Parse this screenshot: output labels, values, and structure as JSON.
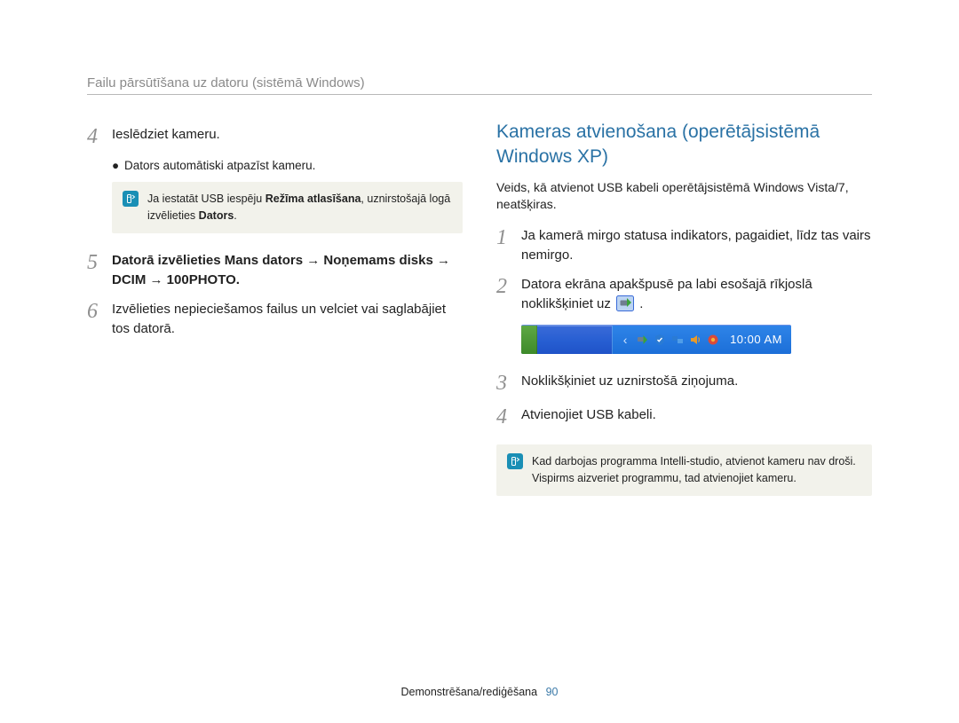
{
  "header": {
    "title": "Failu pārsūtīšana uz datoru (sistēmā Windows)"
  },
  "left": {
    "step4": {
      "num": "4",
      "text": "Ieslēdziet kameru.",
      "bullet": "Dators automātiski atpazīst kameru."
    },
    "note1": {
      "pre": "Ja iestatāt USB iespēju ",
      "bold1": "Režīma atlasīšana",
      "mid": ", uznirstošajā logā izvēlieties ",
      "bold2": "Dators",
      "post": "."
    },
    "step5": {
      "num": "5",
      "pre": "Datorā izvēlieties ",
      "path": "Mans dators → Noņemams disks → DCIM → 100PHOTO",
      "post": "."
    },
    "step6": {
      "num": "6",
      "text": "Izvēlieties nepieciešamos failus un velciet vai saglabājiet tos datorā."
    }
  },
  "right": {
    "title": "Kameras atvienošana (operētājsistēmā Windows XP)",
    "intro": "Veids, kā atvienot USB kabeli operētājsistēmā Windows Vista/7, neatšķiras.",
    "step1": {
      "num": "1",
      "text": "Ja kamerā mirgo statusa indikators, pagaidiet, līdz tas vairs nemirgo."
    },
    "step2": {
      "num": "2",
      "pre": "Datora ekrāna apakšpusē pa labi esošajā rīkjoslā noklikšķiniet uz ",
      "post": "."
    },
    "taskbar": {
      "clock": "10:00 AM"
    },
    "step3": {
      "num": "3",
      "text": "Noklikšķiniet uz uznirstošā ziņojuma."
    },
    "step4": {
      "num": "4",
      "text": "Atvienojiet USB kabeli."
    },
    "note2": "Kad darbojas programma Intelli-studio, atvienot kameru nav droši. Vispirms aizveriet programmu, tad atvienojiet kameru."
  },
  "footer": {
    "text": "Demonstrēšana/rediģēšana",
    "page": "90"
  }
}
